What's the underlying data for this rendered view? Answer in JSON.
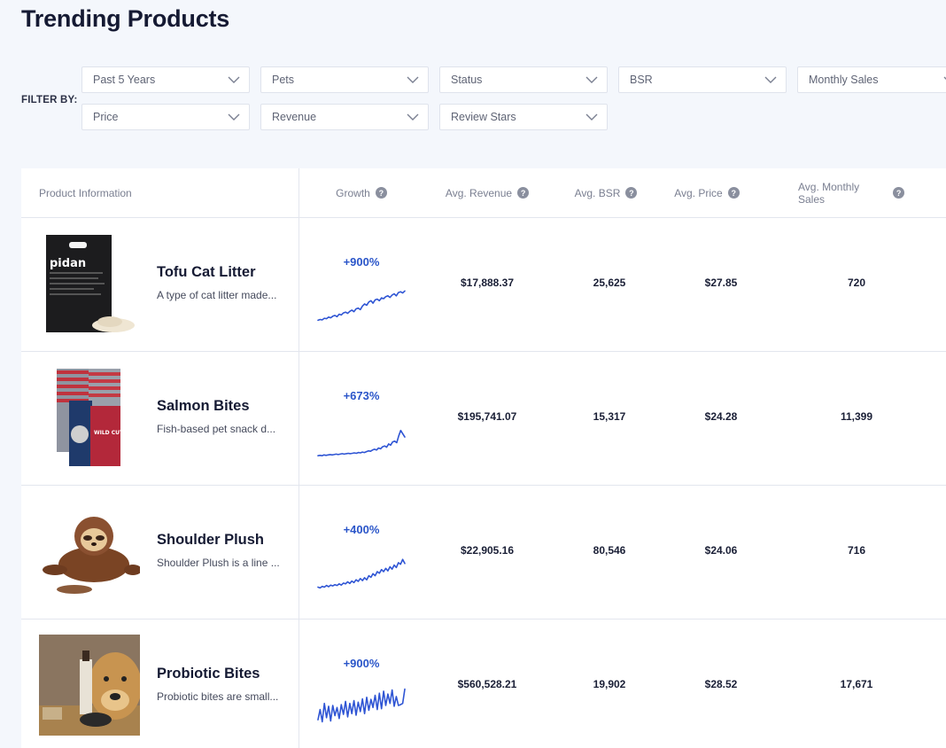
{
  "page": {
    "title": "Trending Products"
  },
  "filters": {
    "label": "FILTER BY:",
    "items": [
      "Past 5 Years",
      "Pets",
      "Status",
      "BSR",
      "Monthly Sales",
      "Price",
      "Revenue",
      "Review Stars"
    ]
  },
  "table": {
    "columns": [
      {
        "label": "Product Information",
        "help": false
      },
      {
        "label": "Growth",
        "help": true
      },
      {
        "label": "Avg. Revenue",
        "help": true
      },
      {
        "label": "Avg. BSR",
        "help": true
      },
      {
        "label": "Avg. Price",
        "help": true
      },
      {
        "label": "Avg. Monthly Sales",
        "help": true
      }
    ],
    "rows": [
      {
        "name": "Tofu Cat Litter",
        "description": "A type of cat litter made...",
        "growth": "+900%",
        "avg_revenue": "$17,888.37",
        "avg_bsr": "25,625",
        "avg_price": "$27.85",
        "avg_monthly_sales": "720",
        "thumb_text": "pidan",
        "sparkline": [
          0.1,
          0.12,
          0.11,
          0.15,
          0.14,
          0.18,
          0.16,
          0.2,
          0.22,
          0.19,
          0.25,
          0.23,
          0.28,
          0.3,
          0.27,
          0.32,
          0.35,
          0.31,
          0.38,
          0.4,
          0.36,
          0.45,
          0.5,
          0.47,
          0.55,
          0.58,
          0.52,
          0.6,
          0.62,
          0.58,
          0.65,
          0.63,
          0.68,
          0.7,
          0.66,
          0.72,
          0.75,
          0.7,
          0.78,
          0.8,
          0.77,
          0.82
        ]
      },
      {
        "name": "Salmon Bites",
        "description": "Fish-based pet snack d...",
        "growth": "+673%",
        "avg_revenue": "$195,741.07",
        "avg_bsr": "15,317",
        "avg_price": "$24.28",
        "avg_monthly_sales": "11,399",
        "thumb_text": "WILD CUTS",
        "sparkline": [
          0.06,
          0.07,
          0.06,
          0.08,
          0.07,
          0.08,
          0.09,
          0.08,
          0.09,
          0.1,
          0.09,
          0.1,
          0.11,
          0.1,
          0.11,
          0.12,
          0.11,
          0.12,
          0.13,
          0.12,
          0.14,
          0.13,
          0.15,
          0.14,
          0.16,
          0.18,
          0.17,
          0.2,
          0.22,
          0.2,
          0.25,
          0.23,
          0.28,
          0.3,
          0.27,
          0.35,
          0.32,
          0.4,
          0.42,
          0.38,
          0.55,
          0.68,
          0.6,
          0.52
        ]
      },
      {
        "name": "Shoulder Plush",
        "description": "Shoulder Plush is a line ...",
        "growth": "+400%",
        "avg_revenue": "$22,905.16",
        "avg_bsr": "80,546",
        "avg_price": "$24.06",
        "avg_monthly_sales": "716",
        "thumb_text": "",
        "sparkline": [
          0.12,
          0.1,
          0.14,
          0.12,
          0.16,
          0.13,
          0.17,
          0.15,
          0.18,
          0.16,
          0.2,
          0.17,
          0.22,
          0.2,
          0.25,
          0.21,
          0.27,
          0.23,
          0.3,
          0.26,
          0.33,
          0.28,
          0.35,
          0.3,
          0.4,
          0.36,
          0.45,
          0.4,
          0.5,
          0.46,
          0.55,
          0.5,
          0.58,
          0.52,
          0.62,
          0.56,
          0.66,
          0.6,
          0.72,
          0.68,
          0.8,
          0.7
        ]
      },
      {
        "name": "Probiotic Bites",
        "description": "Probiotic bites are small...",
        "growth": "+900%",
        "avg_revenue": "$560,528.21",
        "avg_bsr": "19,902",
        "avg_price": "$28.52",
        "avg_monthly_sales": "17,671",
        "thumb_text": "",
        "sparkline": [
          0.15,
          0.4,
          0.1,
          0.55,
          0.2,
          0.48,
          0.12,
          0.5,
          0.25,
          0.45,
          0.18,
          0.52,
          0.28,
          0.6,
          0.22,
          0.55,
          0.3,
          0.62,
          0.26,
          0.58,
          0.35,
          0.66,
          0.3,
          0.7,
          0.38,
          0.65,
          0.45,
          0.75,
          0.4,
          0.8,
          0.42,
          0.85,
          0.5,
          0.78,
          0.55,
          0.88,
          0.48,
          0.72,
          0.5,
          0.52,
          0.55,
          0.9
        ]
      }
    ]
  },
  "colors": {
    "accent": "#2a55c9",
    "sparkline": "#2f55d4",
    "background": "#f4f7fc"
  }
}
